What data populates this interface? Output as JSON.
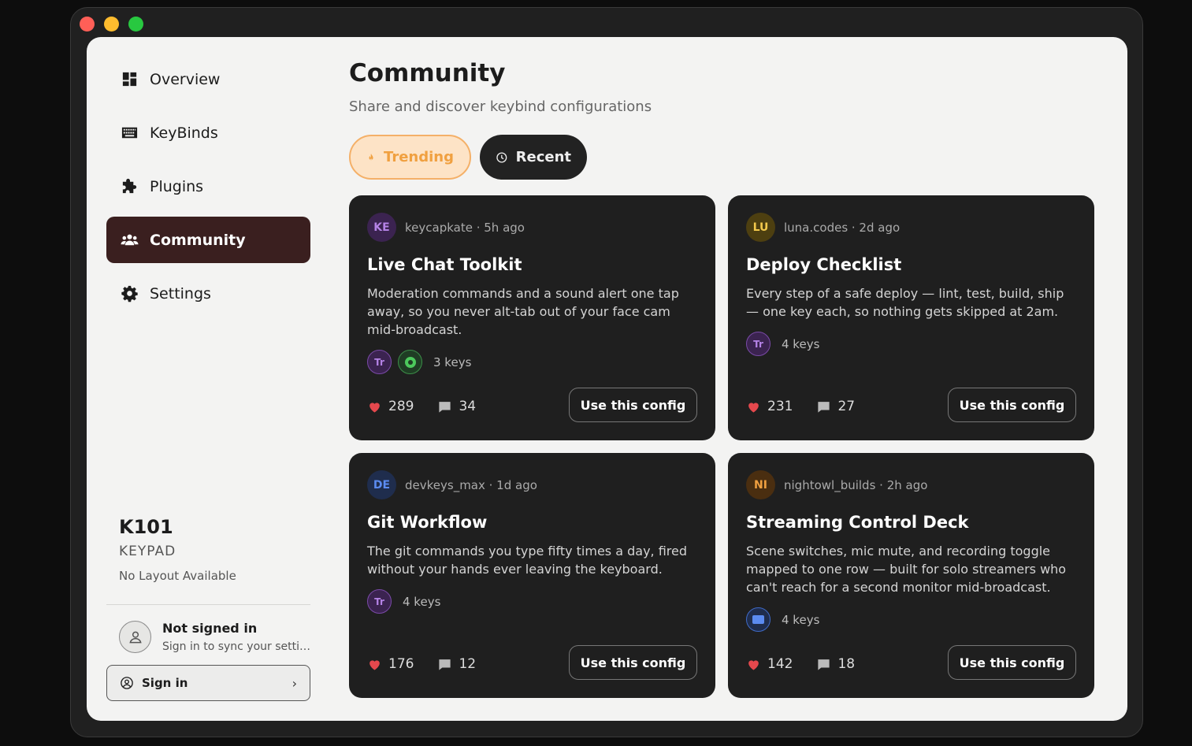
{
  "sidebar": {
    "items": [
      {
        "label": "Overview",
        "icon": "dashboard-icon"
      },
      {
        "label": "KeyBinds",
        "icon": "keyboard-icon"
      },
      {
        "label": "Plugins",
        "icon": "puzzle-icon"
      },
      {
        "label": "Community",
        "icon": "users-icon",
        "active": true
      },
      {
        "label": "Settings",
        "icon": "gear-icon"
      }
    ],
    "device": {
      "name": "K101",
      "type": "KEYPAD",
      "layout": "No Layout Available"
    },
    "user": {
      "status": "Not signed in",
      "hint": "Sign in to sync your settings across devices"
    },
    "signin": {
      "label": "Sign in",
      "chevron": "›"
    }
  },
  "main": {
    "title": "Community",
    "subtitle": "Share and discover keybind configurations",
    "tabs": [
      {
        "label": "Trending",
        "icon": "flame-icon",
        "active": true
      },
      {
        "label": "Recent",
        "icon": "clock-icon"
      }
    ],
    "cards": [
      {
        "initials": "KE",
        "avatar_bg": "#3b2350",
        "avatar_fg": "#b583e6",
        "meta": "keycapkate · 5h ago",
        "title": "Live Chat Toolkit",
        "desc": "Moderation commands and a sound alert one tap away, so you never alt-tab out of your face cam mid-broadcast.",
        "badge_1": "Tr",
        "keys": "3 keys",
        "likes": "289",
        "comments": "34",
        "button": "Use this config"
      },
      {
        "initials": "LU",
        "avatar_bg": "#4d3f10",
        "avatar_fg": "#f2c94c",
        "meta": "luna.codes · 2d ago",
        "title": "Deploy Checklist",
        "desc": "Every step of a safe deploy — lint, test, build, ship — one key each, so nothing gets skipped at 2am.",
        "badge_1": "Tr",
        "keys": "4 keys",
        "likes": "231",
        "comments": "27",
        "button": "Use this config"
      },
      {
        "initials": "DE",
        "avatar_bg": "#1f2d4d",
        "avatar_fg": "#5b8bf0",
        "meta": "devkeys_max · 1d ago",
        "title": "Git Workflow",
        "desc": "The git commands you type fifty times a day, fired without your hands ever leaving the keyboard.",
        "badge_1": "Tr",
        "keys": "4 keys",
        "likes": "176",
        "comments": "12",
        "button": "Use this config"
      },
      {
        "initials": "NI",
        "avatar_bg": "#4a2e10",
        "avatar_fg": "#f0a040",
        "meta": "nightowl_builds · 2h ago",
        "title": "Streaming Control Deck",
        "desc": "Scene switches, mic mute, and recording toggle mapped to one row — built for solo streamers who can't reach for a second monitor mid-broadcast.",
        "keys": "4 keys",
        "likes": "142",
        "comments": "18",
        "button": "Use this config"
      }
    ]
  },
  "colors": {
    "accent": "#3a1f1f",
    "trending": "#f0a040",
    "like": "#e5484d"
  }
}
